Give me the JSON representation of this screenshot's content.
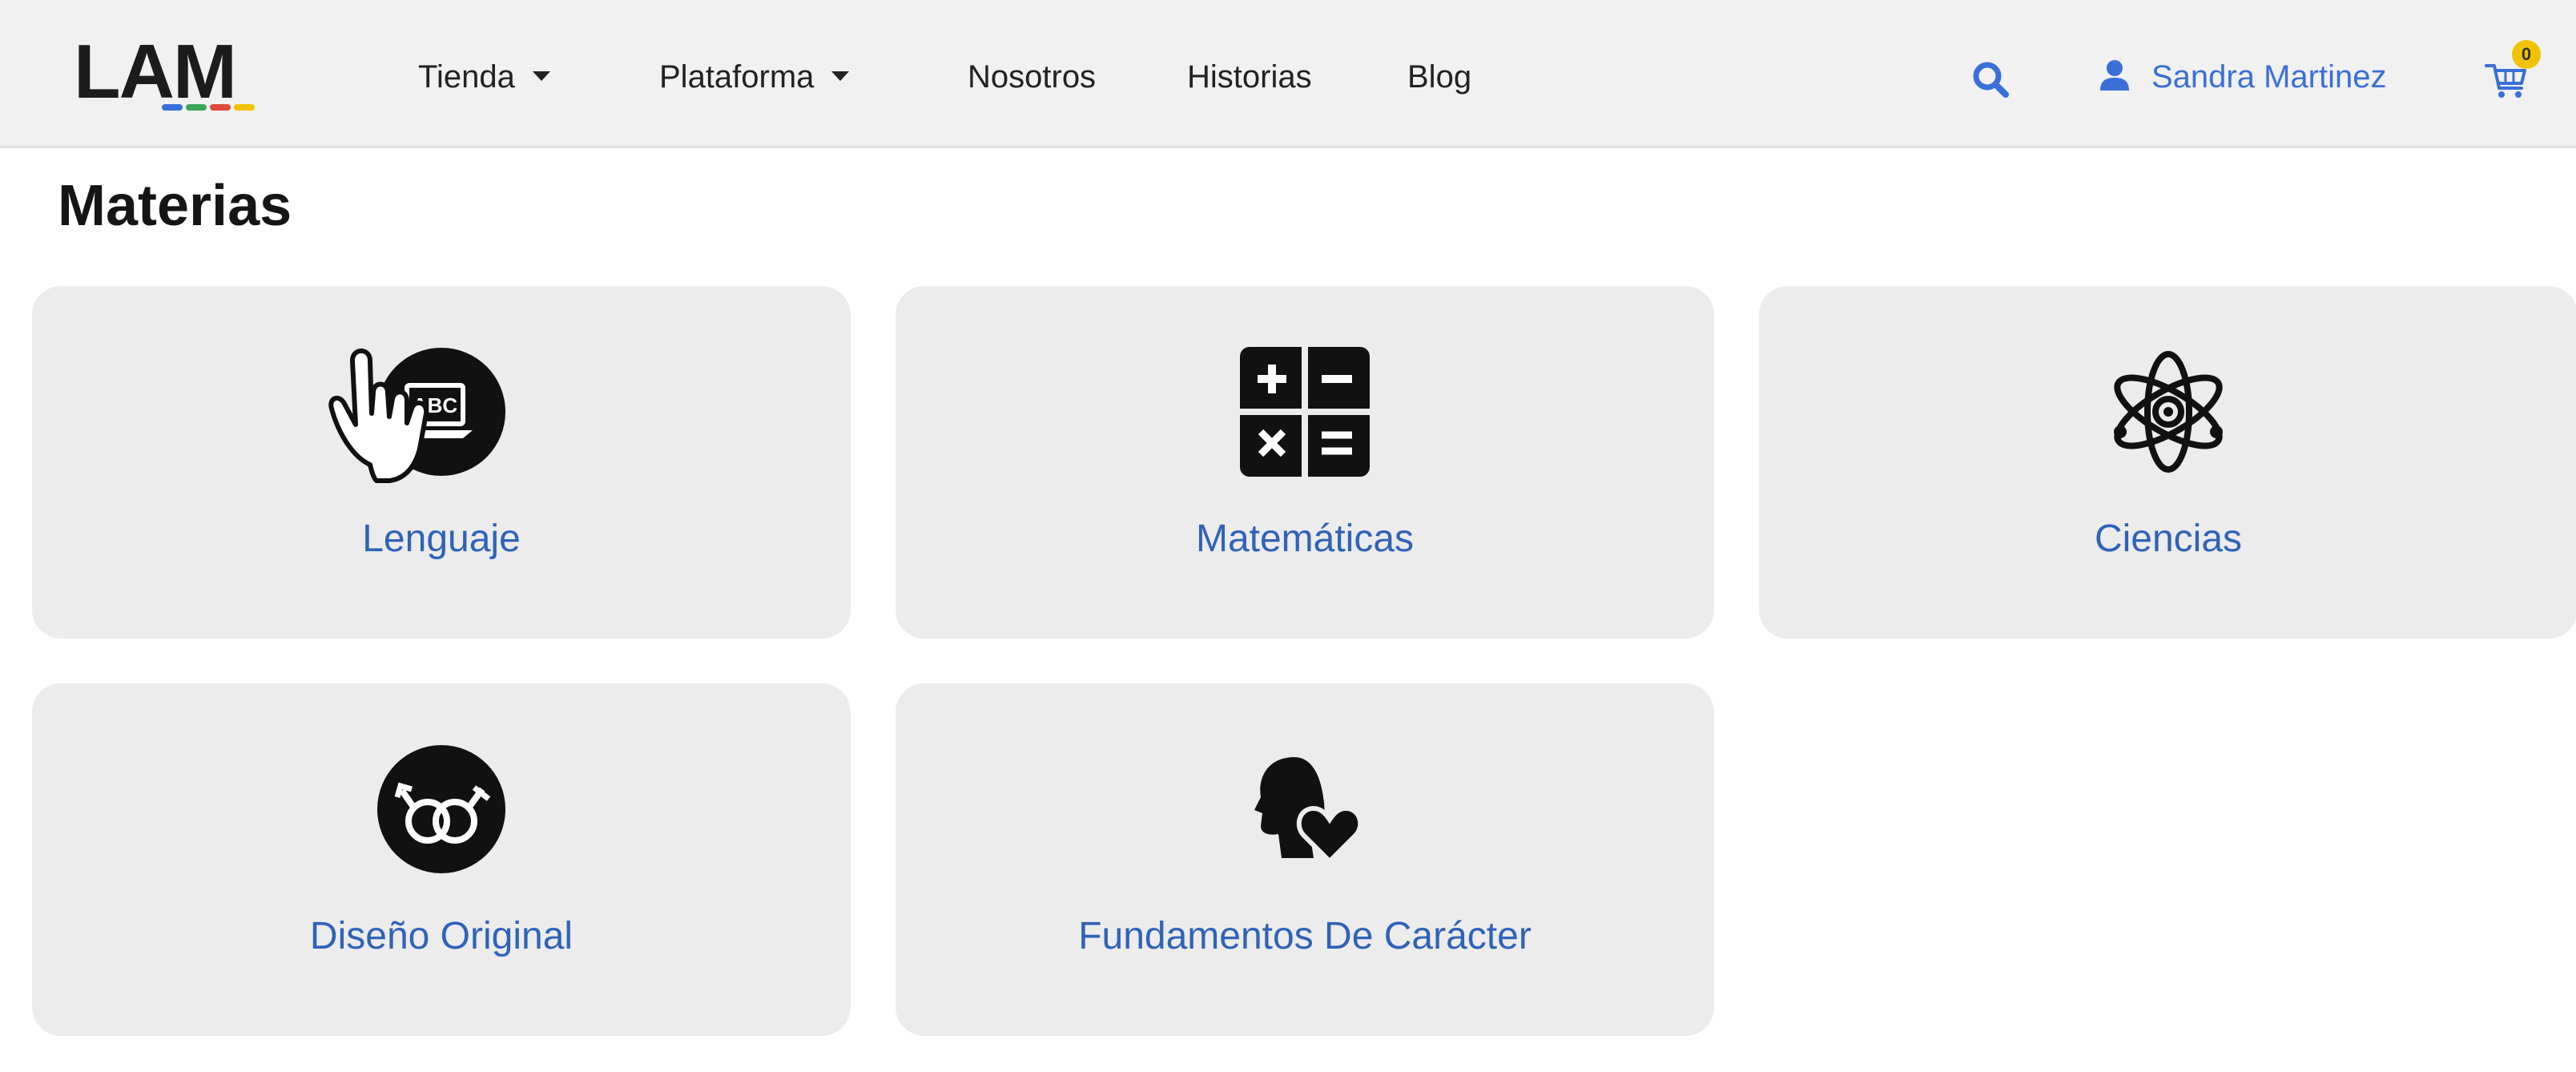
{
  "navbar": {
    "logo_text": "LAM",
    "logo_colors": [
      "#3a6fd8",
      "#3aa55a",
      "#e04a3a",
      "#f2c200"
    ],
    "menu": [
      {
        "label": "Tienda",
        "has_dropdown": true
      },
      {
        "label": "Plataforma",
        "has_dropdown": true
      },
      {
        "label": "Nosotros",
        "has_dropdown": false
      },
      {
        "label": "Historias",
        "has_dropdown": false
      },
      {
        "label": "Blog",
        "has_dropdown": false
      }
    ],
    "search_icon": "search-icon",
    "user_name": "Sandra Martinez",
    "user_icon": "user-icon",
    "cart_icon": "cart-icon",
    "cart_count": "0"
  },
  "page_title": "Materias",
  "subjects": [
    {
      "label": "Lenguaje",
      "icon": "abc-laptop-icon"
    },
    {
      "label": "Matemáticas",
      "icon": "calculator-icon"
    },
    {
      "label": "Ciencias",
      "icon": "atom-icon"
    },
    {
      "label": "Diseño Original",
      "icon": "gender-symbols-icon"
    },
    {
      "label": "Fundamentos De Carácter",
      "icon": "head-heart-icon"
    }
  ],
  "colors": {
    "accent": "#3a6fd8",
    "label_blue": "#2f63b8",
    "card_bg": "#ececec",
    "nav_bg": "#f1f1f1",
    "badge": "#f2c200"
  }
}
